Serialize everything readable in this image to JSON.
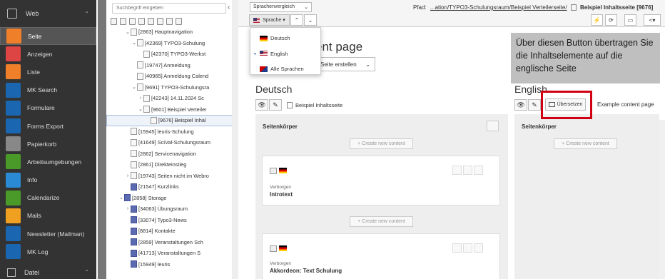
{
  "sidebar": {
    "group_top": "Web",
    "items": [
      {
        "label": "Seite",
        "icon": "page-icon",
        "color": "#f07f2a",
        "active": true
      },
      {
        "label": "Anzeigen",
        "icon": "eye-icon",
        "color": "#d44"
      },
      {
        "label": "Liste",
        "icon": "list-icon",
        "color": "#f07f2a"
      },
      {
        "label": "MK Search",
        "icon": "search-icon",
        "color": "#1a66b0"
      },
      {
        "label": "Formulare",
        "icon": "form-icon",
        "color": "#1a66b0"
      },
      {
        "label": "Forms Export",
        "icon": "export-icon",
        "color": "#1a66b0"
      },
      {
        "label": "Papierkorb",
        "icon": "trash-icon",
        "color": "#888"
      },
      {
        "label": "Arbeitsumgebungen",
        "icon": "workspace-icon",
        "color": "#4a9a2a"
      },
      {
        "label": "Info",
        "icon": "info-icon",
        "color": "#2a8ad4"
      },
      {
        "label": "Calendarize",
        "icon": "calendar-icon",
        "color": "#4a9a2a"
      },
      {
        "label": "Mails",
        "icon": "mail-icon",
        "color": "#f0a020"
      },
      {
        "label": "Newsletter (Mailman)",
        "icon": "newsletter-icon",
        "color": "#1a66b0"
      },
      {
        "label": "MK Log",
        "icon": "log-icon",
        "color": "#1a66b0"
      }
    ],
    "group_bottom": "Datei"
  },
  "tree": {
    "search_placeholder": "Suchbegriff eingeben",
    "rows": [
      {
        "label": "[2863] Hauptnavigation",
        "indent": 2,
        "arrow": "⌄"
      },
      {
        "label": "[42369] TYPO3-Schulung",
        "indent": 3,
        "arrow": "⌄"
      },
      {
        "label": "[42370] TYPO3-Werkst",
        "indent": 4,
        "arrow": ""
      },
      {
        "label": "[19747] Anmeldung",
        "indent": 3,
        "arrow": ""
      },
      {
        "label": "[40965] Anmeldung Calend",
        "indent": 3,
        "arrow": ""
      },
      {
        "label": "[9691] TYPO3-Schulungsra",
        "indent": 3,
        "arrow": "⌄"
      },
      {
        "label": "[42243] 14.11.2024 Sc",
        "indent": 4,
        "arrow": "›"
      },
      {
        "label": "[9601] Beispiel Verteiler",
        "indent": 4,
        "arrow": "⌄"
      },
      {
        "label": "[9676] Beispiel Inhal",
        "indent": 5,
        "arrow": "",
        "selected": true
      },
      {
        "label": "[15945] leuris-Schulung",
        "indent": 2,
        "arrow": ""
      },
      {
        "label": "[41649] SciVal-Schulungsraum",
        "indent": 2,
        "arrow": ""
      },
      {
        "label": "[2862] Servicenavigation",
        "indent": 2,
        "arrow": ""
      },
      {
        "label": "[2861] Direkteinstieg",
        "indent": 2,
        "arrow": ""
      },
      {
        "label": "[19743] Seiten nicht im Webro",
        "indent": 2,
        "arrow": "›"
      },
      {
        "label": "[21547] Kurzlinks",
        "indent": 2,
        "arrow": "",
        "folder": true
      },
      {
        "label": "[2858] Storage",
        "indent": 1,
        "arrow": "⌄",
        "folder": true
      },
      {
        "label": "[34063] Übungsraum",
        "indent": 2,
        "arrow": "›",
        "folder": true
      },
      {
        "label": "[33074] Typo3-News",
        "indent": 2,
        "arrow": "",
        "folder": true
      },
      {
        "label": "[8814] Kontakte",
        "indent": 2,
        "arrow": "",
        "folder": true
      },
      {
        "label": "[2859] Veranstaltungen Sch",
        "indent": 2,
        "arrow": "",
        "folder": true
      },
      {
        "label": "[41713] Veranstaltungen S",
        "indent": 2,
        "arrow": "",
        "folder": true
      },
      {
        "label": "[15949] leuris",
        "indent": 2,
        "arrow": "",
        "folder": true
      }
    ]
  },
  "docheader": {
    "mode_select": "Sprachenvergleich",
    "language_button": "Sprache",
    "pfad_label": "Pfad:",
    "pfad_path": "...ation/TYPO3-Schulungsraum/Beispiel Verteilerseite/",
    "pfad_page": "Beispiel Inhaltsseite [9676]"
  },
  "language_dropdown": [
    {
      "label": "Deutsch",
      "flag": "de",
      "current": false
    },
    {
      "label": "English",
      "flag": "en",
      "current": true
    },
    {
      "label": "Alle Sprachen",
      "flag": "all",
      "current": false
    }
  ],
  "page_title_partial": "ent page",
  "create_page_label": "Seite erstellen",
  "columns": {
    "de": {
      "heading": "Deutsch",
      "page_link": "Beispiel Inhaltsseite",
      "area_title": "Seitenkörper",
      "create_label": "+ Create new content",
      "elements": [
        {
          "hidden_label": "Verborgen",
          "title": "Introtext"
        },
        {
          "hidden_label": "Verborgen",
          "title": "Akkordeon: Text Schulung"
        }
      ]
    },
    "en": {
      "heading": "English",
      "translate_button": "Übersetzen",
      "page_link": "Example content page",
      "area_title": "Seitenkörper",
      "create_label": "+ Create new content"
    }
  },
  "annotation": "Über diesen Button übertragen Sie die Inhaltselemente auf die englische Seite",
  "accent_color": "#d00012"
}
